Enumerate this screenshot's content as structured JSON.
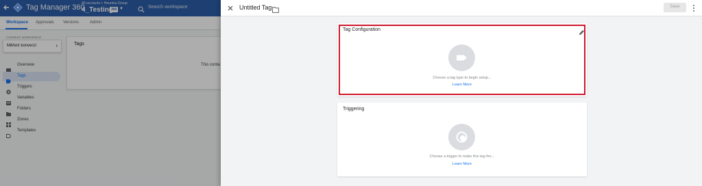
{
  "app": {
    "product_name": "Tag Manager 360",
    "breadcrumb": "All accounts > Heureka Group",
    "container_name": "4_Testing",
    "container_badge": "360",
    "search_placeholder": "Search workspace"
  },
  "nav_tabs": [
    {
      "label": "Workspace",
      "active": true
    },
    {
      "label": "Approvals",
      "active": false
    },
    {
      "label": "Versions",
      "active": false
    },
    {
      "label": "Admin",
      "active": false
    }
  ],
  "workspace": {
    "section_label": "CURRENT WORKSPACE",
    "selected": "Měření konverzí"
  },
  "sidebar": {
    "items": [
      {
        "label": "Overview",
        "icon": "overview-icon",
        "active": false
      },
      {
        "label": "Tags",
        "icon": "tag-icon",
        "active": true
      },
      {
        "label": "Triggers",
        "icon": "trigger-icon",
        "active": false
      },
      {
        "label": "Variables",
        "icon": "variables-icon",
        "active": false
      },
      {
        "label": "Folders",
        "icon": "folder-icon",
        "active": false
      },
      {
        "label": "Zones",
        "icon": "zones-icon",
        "active": false
      },
      {
        "label": "Templates",
        "icon": "templates-icon",
        "active": false
      }
    ]
  },
  "tags_card": {
    "title": "Tags",
    "body": "This conta"
  },
  "editor": {
    "title": "Untitled Tag",
    "save_label": "Save",
    "tag_configuration": {
      "title": "Tag Configuration",
      "hint": "Choose a tag type to begin setup...",
      "link": "Learn More"
    },
    "triggering": {
      "title": "Triggering",
      "hint": "Choose a trigger to make this tag fire...",
      "link": "Learn More"
    }
  },
  "colors": {
    "brand_blue": "#2d5ea9",
    "link_blue": "#1a73e8",
    "highlight_red": "#d0142a"
  }
}
